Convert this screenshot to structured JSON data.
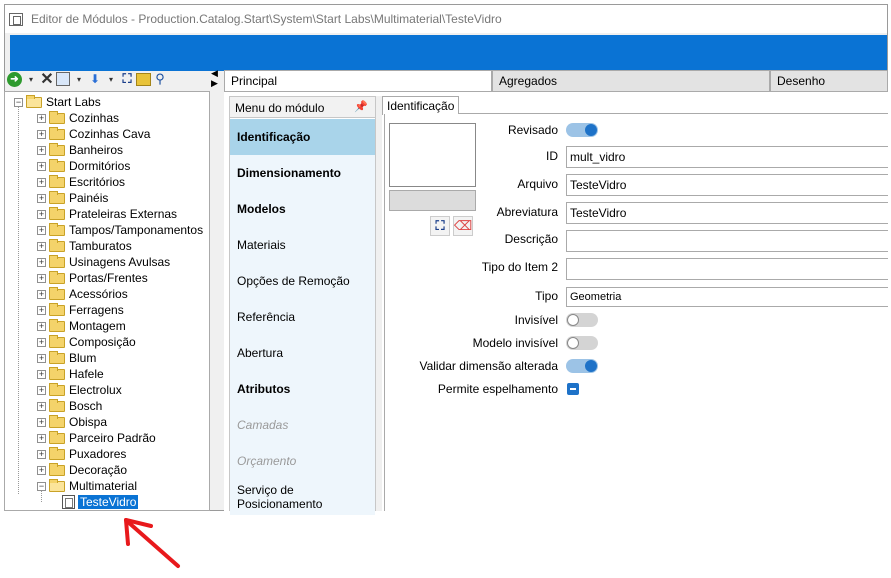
{
  "window": {
    "title": "Editor de Módulos - Production.Catalog.Start\\System\\Start Labs\\Multimaterial\\TesteVidro"
  },
  "toolbar": {
    "icons": [
      "go-icon",
      "dropdown-icon",
      "delete-icon",
      "copy-icon",
      "dropdown-icon",
      "move-down-icon",
      "dropdown-icon",
      "find-icon",
      "open-folder-icon",
      "walk-icon"
    ]
  },
  "tree": {
    "root": "Start Labs",
    "items": [
      {
        "label": "Cozinhas"
      },
      {
        "label": "Cozinhas Cava"
      },
      {
        "label": "Banheiros"
      },
      {
        "label": "Dormitórios"
      },
      {
        "label": "Escritórios"
      },
      {
        "label": "Painéis"
      },
      {
        "label": "Prateleiras Externas"
      },
      {
        "label": "Tampos/Tamponamentos"
      },
      {
        "label": "Tamburatos"
      },
      {
        "label": "Usinagens Avulsas"
      },
      {
        "label": "Portas/Frentes"
      },
      {
        "label": "Acessórios"
      },
      {
        "label": "Ferragens"
      },
      {
        "label": "Montagem"
      },
      {
        "label": "Composição"
      },
      {
        "label": "Blum"
      },
      {
        "label": "Hafele"
      },
      {
        "label": "Electrolux"
      },
      {
        "label": "Bosch"
      },
      {
        "label": "Obispa"
      },
      {
        "label": "Parceiro Padrão"
      },
      {
        "label": "Puxadores"
      },
      {
        "label": "Decoração"
      },
      {
        "label": "Multimaterial"
      }
    ],
    "selected_child": "TesteVidro"
  },
  "main_tabs": [
    {
      "label": "Principal"
    },
    {
      "label": "Agregados"
    },
    {
      "label": "Desenho"
    }
  ],
  "menu": {
    "header": "Menu do módulo",
    "items": [
      {
        "label": "Identificação",
        "style": "bold selected"
      },
      {
        "label": "Dimensionamento",
        "style": "bold"
      },
      {
        "label": "Modelos",
        "style": "bold"
      },
      {
        "label": "Materiais",
        "style": "normal"
      },
      {
        "label": "Opções de Remoção",
        "style": "normal"
      },
      {
        "label": "Referência",
        "style": "normal"
      },
      {
        "label": "Abertura",
        "style": "normal"
      },
      {
        "label": "Atributos",
        "style": "bold"
      },
      {
        "label": "Camadas",
        "style": "disabled"
      },
      {
        "label": "Orçamento",
        "style": "disabled"
      },
      {
        "label": "Serviço de Posicionamento",
        "style": "normal"
      }
    ]
  },
  "form": {
    "tab": "Identificação",
    "revisado_label": "Revisado",
    "revisado": true,
    "id_label": "ID",
    "id_value": "mult_vidro",
    "arquivo_label": "Arquivo",
    "arquivo_value": "TesteVidro",
    "abreviatura_label": "Abreviatura",
    "abreviatura_value": "TesteVidro",
    "descricao_label": "Descrição",
    "descricao_value": "",
    "tipo_item2_label": "Tipo do Item 2",
    "tipo_item2_value": "",
    "tipo_label": "Tipo",
    "tipo_value": "Geometria",
    "invisivel_label": "Invisível",
    "invisivel": false,
    "modelo_invisivel_label": "Modelo invisível",
    "modelo_invisivel": false,
    "validar_label": "Validar dimensão alterada",
    "validar": true,
    "permite_espelhamento_label": "Permite espelhamento",
    "permite_espelhamento": "indeterminate"
  },
  "colors": {
    "ribbon": "#0a73d4",
    "selection": "#0a73d4",
    "menu_selected": "#a9d4ea",
    "toggle_on": "#1e72c8",
    "annotation_arrow": "#e8191c"
  }
}
